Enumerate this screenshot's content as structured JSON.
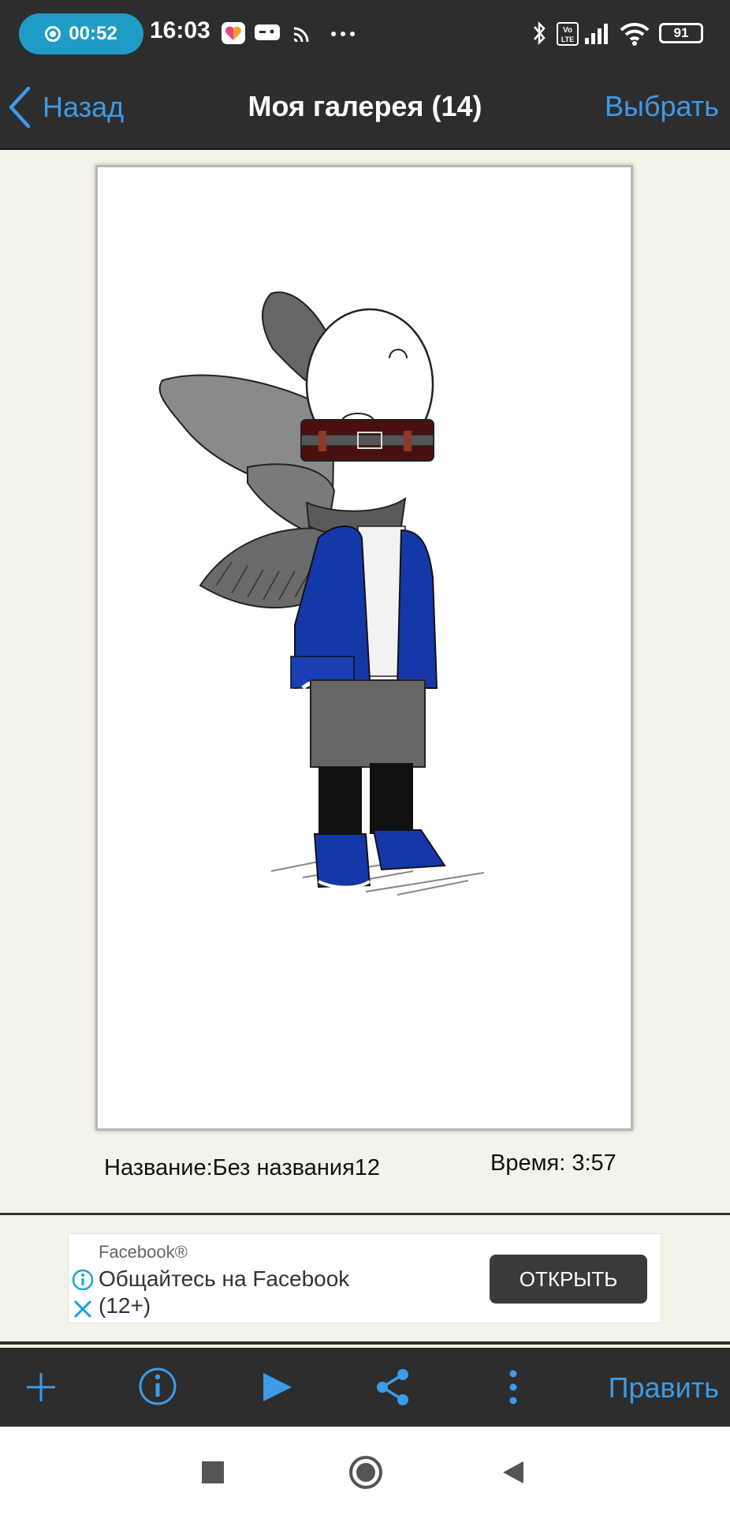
{
  "status_bar": {
    "recording_time": "00:52",
    "clock": "16:03",
    "battery": "91",
    "icons": [
      "record-icon",
      "app-heart-icon",
      "gamepad-icon",
      "cast-icon",
      "more-dots-icon",
      "bluetooth-icon",
      "volte-icon",
      "signal-icon",
      "wifi-icon",
      "battery-icon"
    ]
  },
  "header": {
    "back_label": "Назад",
    "title": "Моя галерея (14)",
    "select_label": "Выбрать"
  },
  "artwork": {
    "name_text": "Название:Без названия12",
    "time_text": "Время:  3:57"
  },
  "ad": {
    "brand": "Facebook®",
    "text": "Общайтесь на Facebook (12+)",
    "button": "ОТКРЫТЬ"
  },
  "toolbar": {
    "icons": [
      "add-icon",
      "info-icon",
      "play-icon",
      "share-icon",
      "more-vertical-icon"
    ],
    "edit_label": "Править"
  },
  "colors": {
    "accent": "#3c9be8",
    "bar": "#2d2d2d",
    "background": "#f4f3ea",
    "recording": "#1e9cc6"
  }
}
